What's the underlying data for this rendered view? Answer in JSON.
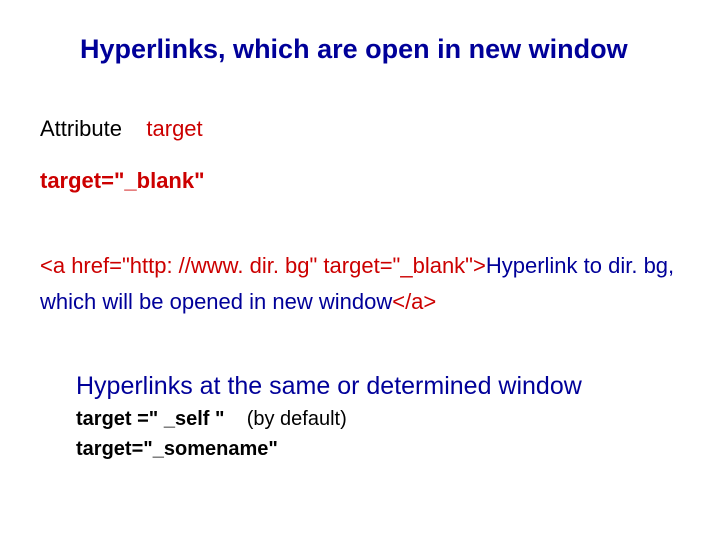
{
  "title": "Hyperlinks, which are open in new window",
  "attr_label": "Attribute",
  "attr_name": "target",
  "target_blank": "target=\"_blank\"",
  "code": {
    "open_tag": "<a href=\"http: //www. dir. bg\" target=\"_blank\">",
    "link_text": "Hyperlink to dir. bg, which will be opened in new window",
    "close_tag": "</a>"
  },
  "subhead": "Hyperlinks at the same or determined window",
  "self_kw": "target =\" _self \"",
  "self_note": "(by default)",
  "somename": "target=\"_somename\""
}
